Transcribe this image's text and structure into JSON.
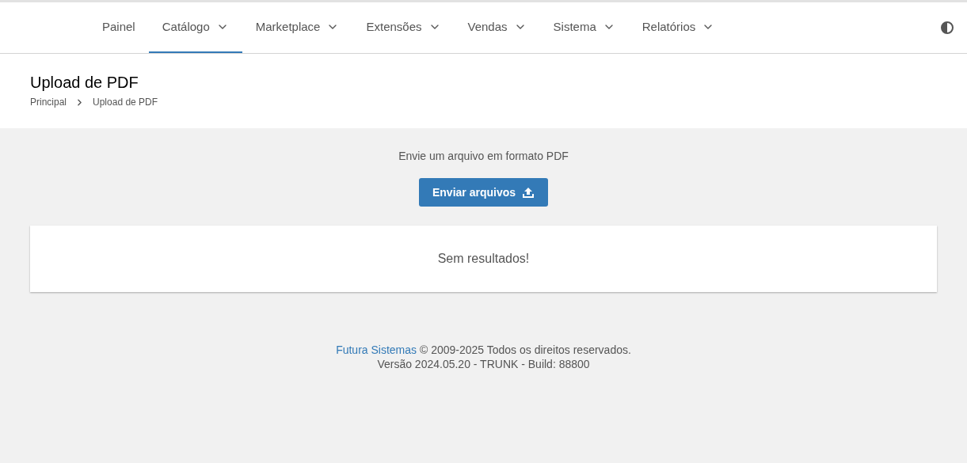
{
  "nav": {
    "items": [
      {
        "label": "Painel",
        "selected": false,
        "dropdown": false
      },
      {
        "label": "Catálogo",
        "selected": true,
        "dropdown": true
      },
      {
        "label": "Marketplace",
        "selected": false,
        "dropdown": true
      },
      {
        "label": "Extensões",
        "selected": false,
        "dropdown": true
      },
      {
        "label": "Vendas",
        "selected": false,
        "dropdown": true
      },
      {
        "label": "Sistema",
        "selected": false,
        "dropdown": true
      },
      {
        "label": "Relatórios",
        "selected": false,
        "dropdown": true
      }
    ]
  },
  "page": {
    "title": "Upload de PDF",
    "breadcrumb": [
      "Principal",
      "Upload de PDF"
    ]
  },
  "upload": {
    "instruction": "Envie um arquivo em formato PDF",
    "button": "Enviar arquivos"
  },
  "results": {
    "message": "Sem resultados!"
  },
  "footer": {
    "company_link": "Futura Sistemas",
    "copyright": "© 2009-2025 Todos os direitos reservados.",
    "version": "Versão 2024.05.20 - TRUNK - Build: 88800"
  }
}
